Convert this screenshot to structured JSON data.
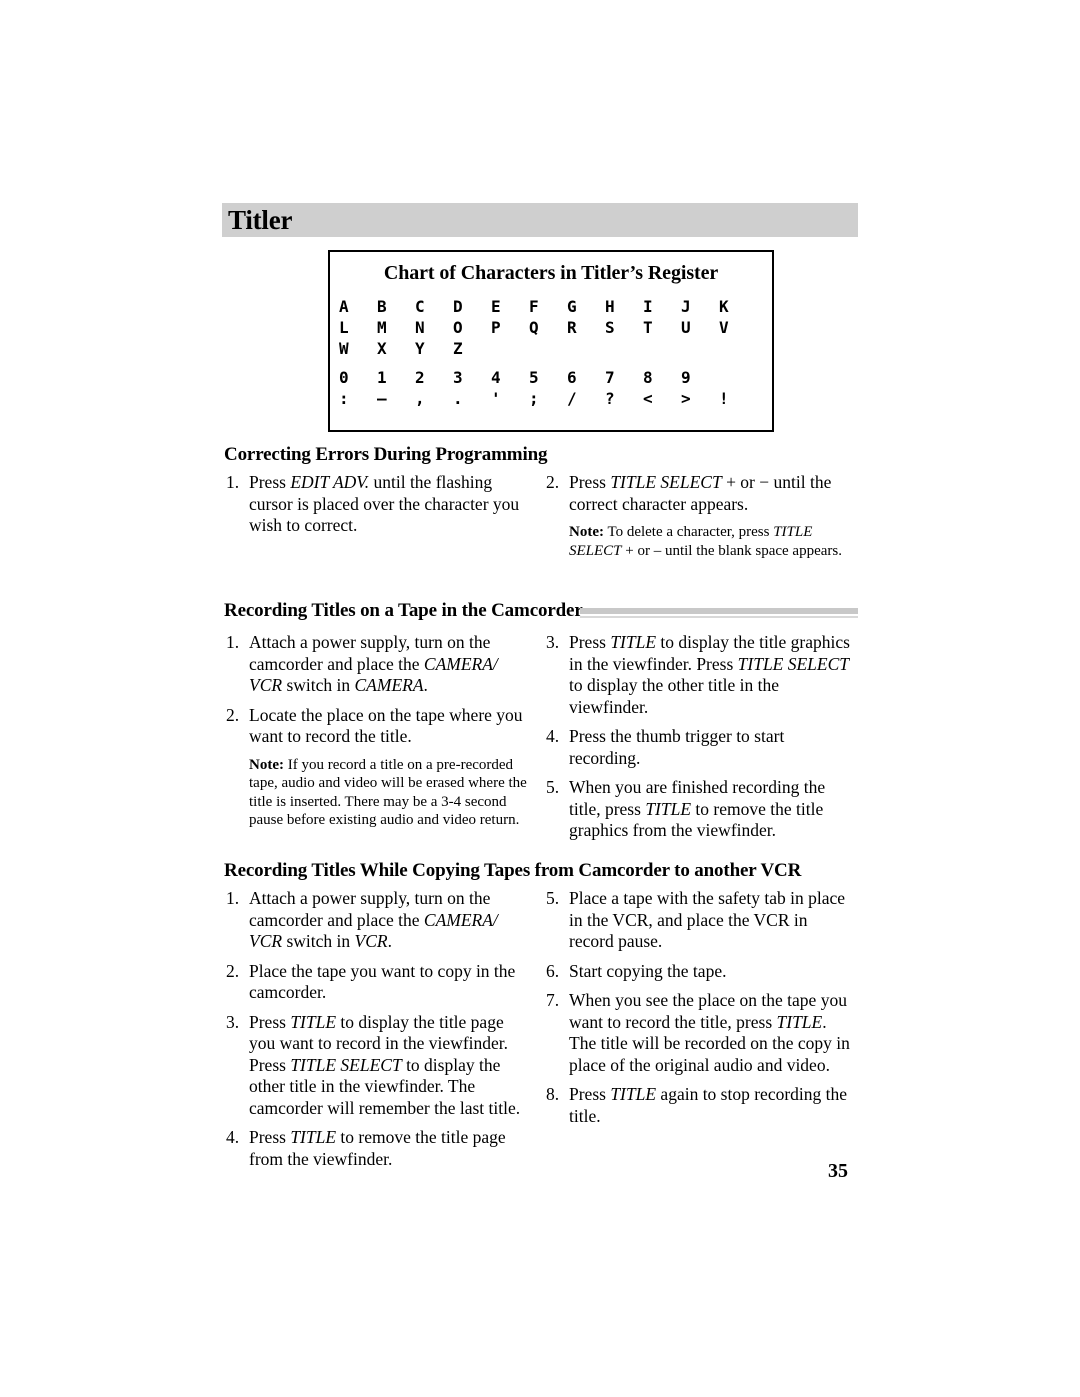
{
  "page": {
    "number": "35",
    "chapter_title": "Titler",
    "header_bar_color": "#cfcfcf",
    "rule_color": "#c8c8c8",
    "background": "#ffffff"
  },
  "character_chart": {
    "title": "Chart of Characters in Titler’s Register",
    "rows": [
      [
        "A",
        "B",
        "C",
        "D",
        "E",
        "F",
        "G",
        "H",
        "I",
        "J",
        "K"
      ],
      [
        "L",
        "M",
        "N",
        "O",
        "P",
        "Q",
        "R",
        "S",
        "T",
        "U",
        "V"
      ],
      [
        "W",
        "X",
        "Y",
        "Z",
        "",
        "",
        "",
        "",
        "",
        "",
        ""
      ],
      [
        "0",
        "1",
        "2",
        "3",
        "4",
        "5",
        "6",
        "7",
        "8",
        "9",
        ""
      ],
      [
        ":",
        "–",
        ",",
        ".",
        "'",
        ";",
        "/",
        "?",
        "<",
        ">",
        "!"
      ]
    ]
  },
  "sections": [
    {
      "id": "correcting-errors",
      "heading": "Correcting Errors During Programming",
      "has_rule": false,
      "left_steps": [
        {
          "num": "1.",
          "parts": [
            {
              "t": "Press ",
              "i": false
            },
            {
              "t": "EDIT ADV.",
              "i": true
            },
            {
              "t": " until the flashing cursor is placed over the character you wish to correct.",
              "i": false
            }
          ]
        }
      ],
      "right_steps": [
        {
          "num": "2.",
          "parts": [
            {
              "t": "Press ",
              "i": false
            },
            {
              "t": "TITLE SELECT",
              "i": true
            },
            {
              "t": " + or − until the correct character appears.",
              "i": false
            }
          ],
          "note": {
            "label": "Note:",
            "parts": [
              {
                "t": " To delete a character, press ",
                "i": false
              },
              {
                "t": "TITLE SELECT",
                "i": true
              },
              {
                "t": " + or  – until the blank space appears.",
                "i": false
              }
            ]
          }
        }
      ]
    },
    {
      "id": "recording-titles-camcorder",
      "heading": "Recording Titles on a Tape in the Camcorder",
      "has_rule": true,
      "left_steps": [
        {
          "num": "1.",
          "parts": [
            {
              "t": "Attach a power supply, turn on the camcorder and place the ",
              "i": false
            },
            {
              "t": "CAMERA/ VCR",
              "i": true
            },
            {
              "t": " switch in ",
              "i": false
            },
            {
              "t": "CAMERA",
              "i": true
            },
            {
              "t": ".",
              "i": false
            }
          ]
        },
        {
          "num": "2.",
          "parts": [
            {
              "t": "Locate the place on the tape where you want to record the title.",
              "i": false
            }
          ],
          "note": {
            "label": "Note:",
            "parts": [
              {
                "t": " If you record a title on a pre-recorded tape, audio and video will be erased where the title is inserted.  There may be a 3-4 second pause before existing audio and video return.",
                "i": false
              }
            ]
          }
        }
      ],
      "right_steps": [
        {
          "num": "3.",
          "parts": [
            {
              "t": "Press ",
              "i": false
            },
            {
              "t": "TITLE",
              "i": true
            },
            {
              "t": " to display the title graphics in the viewfinder.  Press ",
              "i": false
            },
            {
              "t": "TITLE SELECT",
              "i": true
            },
            {
              "t": " to display the other title in the viewfinder.",
              "i": false
            }
          ]
        },
        {
          "num": "4.",
          "parts": [
            {
              "t": "Press the thumb trigger to start recording.",
              "i": false
            }
          ]
        },
        {
          "num": "5.",
          "parts": [
            {
              "t": "When you are finished recording the title, press ",
              "i": false
            },
            {
              "t": "TITLE",
              "i": true
            },
            {
              "t": " to remove the title graphics from the viewfinder.",
              "i": false
            }
          ]
        }
      ]
    },
    {
      "id": "recording-titles-copying",
      "heading": "Recording Titles While Copying Tapes from Camcorder to another VCR",
      "has_rule": false,
      "left_steps": [
        {
          "num": "1.",
          "parts": [
            {
              "t": "Attach a power supply, turn on the camcorder and place the ",
              "i": false
            },
            {
              "t": "CAMERA/ VCR",
              "i": true
            },
            {
              "t": " switch in ",
              "i": false
            },
            {
              "t": "VCR",
              "i": true
            },
            {
              "t": ".",
              "i": false
            }
          ]
        },
        {
          "num": "2.",
          "parts": [
            {
              "t": "Place the tape you want to copy in the camcorder.",
              "i": false
            }
          ]
        },
        {
          "num": "3.",
          "parts": [
            {
              "t": "Press ",
              "i": false
            },
            {
              "t": "TITLE",
              "i": true
            },
            {
              "t": " to display the title page you want to record in the viewfinder. Press ",
              "i": false
            },
            {
              "t": "TITLE SELECT",
              "i": true
            },
            {
              "t": " to display the other title in the viewfinder.  The camcorder will remember the last title.",
              "i": false
            }
          ]
        },
        {
          "num": "4.",
          "parts": [
            {
              "t": "Press ",
              "i": false
            },
            {
              "t": "TITLE",
              "i": true
            },
            {
              "t": " to remove the title page from the viewfinder.",
              "i": false
            }
          ]
        }
      ],
      "right_steps": [
        {
          "num": "5.",
          "parts": [
            {
              "t": "Place a tape with the safety tab in place in the VCR, and place the VCR in record pause.",
              "i": false
            }
          ]
        },
        {
          "num": "6.",
          "parts": [
            {
              "t": "Start copying the tape.",
              "i": false
            }
          ]
        },
        {
          "num": "7.",
          "parts": [
            {
              "t": "When you see the place on the tape you want to record the title, press ",
              "i": false
            },
            {
              "t": "TITLE",
              "i": true
            },
            {
              "t": ".  The title will be recorded on the copy in place of the original audio and video.",
              "i": false
            }
          ]
        },
        {
          "num": "8.",
          "parts": [
            {
              "t": "Press ",
              "i": false
            },
            {
              "t": "TITLE",
              "i": true
            },
            {
              "t": " again to stop recording the title.",
              "i": false
            }
          ]
        }
      ]
    }
  ]
}
